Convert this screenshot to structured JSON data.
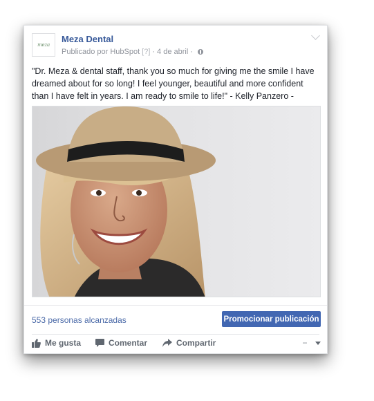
{
  "post": {
    "avatar_text": "meza",
    "page_name": "Meza Dental",
    "published_by": "Publicado por HubSpot",
    "help_marker": "[?]",
    "separator": "·",
    "date": "4 de abril",
    "separator2": "·",
    "text": "\"Dr. Meza & dental staff, thank you so much for giving me the smile I have dreamed about for so long! I feel younger, beautiful and more confident than I have felt in years. I am ready to smile to life!\" - Kelly Panzero -"
  },
  "insights": {
    "reach": "553 personas alcanzadas",
    "promote_label": "Promocionar publicación"
  },
  "actions": {
    "like_label": "Me gusta",
    "comment_label": "Comentar",
    "share_label": "Compartir"
  },
  "colors": {
    "link": "#365899",
    "button": "#4267b2",
    "meta": "#90949c"
  }
}
